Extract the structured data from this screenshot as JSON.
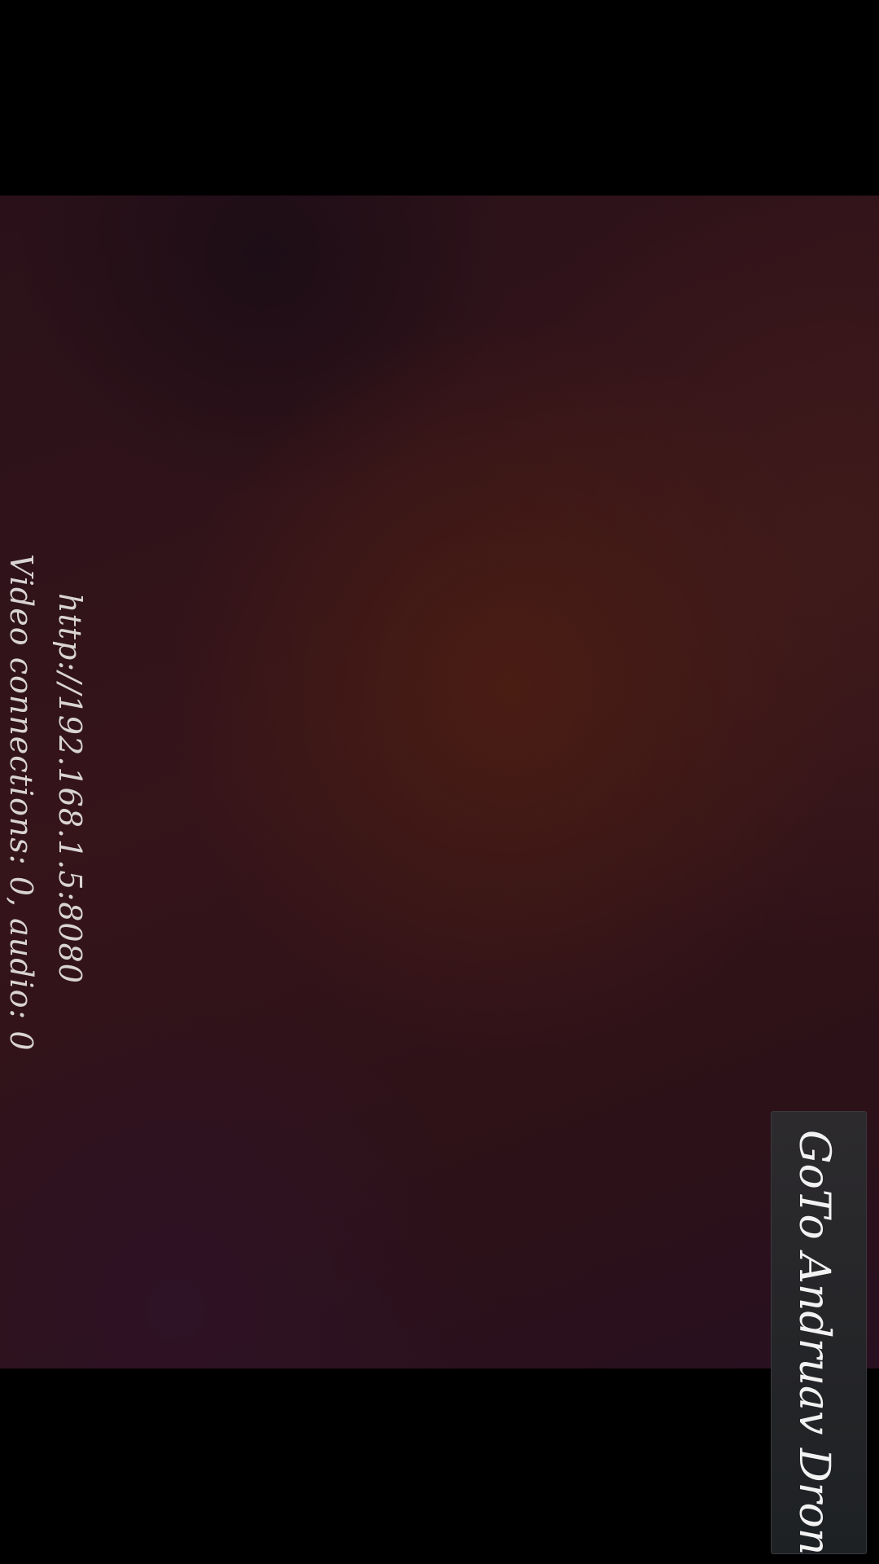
{
  "server": {
    "url": "http://192.168.1.5:8080",
    "connections": "Video connections: 0, audio: 0"
  },
  "actions": {
    "goto_label": "GoTo Andruav Drone"
  }
}
